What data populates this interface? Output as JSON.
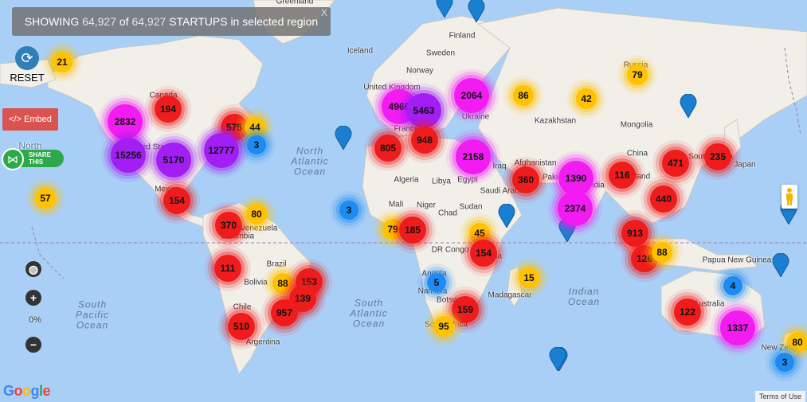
{
  "banner": {
    "prefix": "SHOWING",
    "shown": "64,927",
    "mid": "of",
    "total": "64,927",
    "suffix": "STARTUPS in selected region",
    "close": "X"
  },
  "controls": {
    "reset_label": "RESET",
    "embed_label": "</> Embed",
    "share_label_1": "SHARE",
    "share_label_2": "THIS",
    "zoom_level": "0%",
    "zoom_in": "+",
    "zoom_out": "−",
    "globe": "◍"
  },
  "footer": {
    "google": "Google",
    "terms": "Terms of Use"
  },
  "colors": {
    "water": "#a9cff7",
    "land": "#f2efe9",
    "yellow": "#ffc200",
    "red": "#ee1c1c",
    "magenta": "#f21cf2",
    "purple": "#a21ef2",
    "blue": "#1e8bf2"
  },
  "place_labels": [
    "Greenland",
    "Iceland",
    "Finland",
    "Sweden",
    "Norway",
    "United Kingdom",
    "France",
    "Ukraine",
    "Russia",
    "Kazakhstan",
    "Mongolia",
    "China",
    "South Korea",
    "Japan",
    "Afghanistan",
    "Pakistan",
    "India",
    "Thailand",
    "Iraq",
    "Saudi Arabia",
    "Egypt",
    "Libya",
    "Algeria",
    "Mali",
    "Niger",
    "Chad",
    "Sudan",
    "DR Congo",
    "Angola",
    "Namibia",
    "Botswana",
    "South Africa",
    "Tanzania",
    "Madagascar",
    "Canada",
    "United States",
    "Mexico",
    "Venezuela",
    "Colombia",
    "Brazil",
    "Bolivia",
    "Chile",
    "Argentina",
    "Papua New Guinea",
    "Australia",
    "New Zealand",
    "North"
  ],
  "ocean_labels": [
    "North Atlantic Ocean",
    "South Atlantic Ocean",
    "South Pacific Ocean",
    "Indian Ocean"
  ],
  "clusters": [
    {
      "value": "21",
      "color": "yellow"
    },
    {
      "value": "194",
      "color": "red"
    },
    {
      "value": "2832",
      "color": "magenta"
    },
    {
      "value": "575",
      "color": "red"
    },
    {
      "value": "44",
      "color": "yellow"
    },
    {
      "value": "3",
      "color": "blue"
    },
    {
      "value": "15256",
      "color": "purple"
    },
    {
      "value": "5170",
      "color": "purple"
    },
    {
      "value": "12777",
      "color": "purple"
    },
    {
      "value": "57",
      "color": "yellow"
    },
    {
      "value": "154",
      "color": "red"
    },
    {
      "value": "370",
      "color": "red"
    },
    {
      "value": "80",
      "color": "yellow"
    },
    {
      "value": "111",
      "color": "red"
    },
    {
      "value": "88",
      "color": "yellow"
    },
    {
      "value": "153",
      "color": "red"
    },
    {
      "value": "139",
      "color": "red"
    },
    {
      "value": "957",
      "color": "red"
    },
    {
      "value": "510",
      "color": "red"
    },
    {
      "value": "4966",
      "color": "magenta"
    },
    {
      "value": "5463",
      "color": "purple"
    },
    {
      "value": "2064",
      "color": "magenta"
    },
    {
      "value": "86",
      "color": "yellow"
    },
    {
      "value": "42",
      "color": "yellow"
    },
    {
      "value": "79",
      "color": "yellow"
    },
    {
      "value": "805",
      "color": "red"
    },
    {
      "value": "948",
      "color": "red"
    },
    {
      "value": "2158",
      "color": "magenta"
    },
    {
      "value": "360",
      "color": "red"
    },
    {
      "value": "1390",
      "color": "magenta"
    },
    {
      "value": "2374",
      "color": "magenta"
    },
    {
      "value": "116",
      "color": "red"
    },
    {
      "value": "471",
      "color": "red"
    },
    {
      "value": "235",
      "color": "red"
    },
    {
      "value": "440",
      "color": "red"
    },
    {
      "value": "3",
      "color": "blue"
    },
    {
      "value": "79",
      "color": "yellow"
    },
    {
      "value": "185",
      "color": "red"
    },
    {
      "value": "45",
      "color": "yellow"
    },
    {
      "value": "154",
      "color": "red"
    },
    {
      "value": "5",
      "color": "blue"
    },
    {
      "value": "15",
      "color": "yellow"
    },
    {
      "value": "159",
      "color": "red"
    },
    {
      "value": "95",
      "color": "yellow"
    },
    {
      "value": "913",
      "color": "red"
    },
    {
      "value": "126",
      "color": "red"
    },
    {
      "value": "88",
      "color": "yellow"
    },
    {
      "value": "4",
      "color": "blue"
    },
    {
      "value": "122",
      "color": "red"
    },
    {
      "value": "1337",
      "color": "magenta"
    },
    {
      "value": "80",
      "color": "yellow"
    },
    {
      "value": "3",
      "color": "blue"
    }
  ],
  "pins": 10
}
